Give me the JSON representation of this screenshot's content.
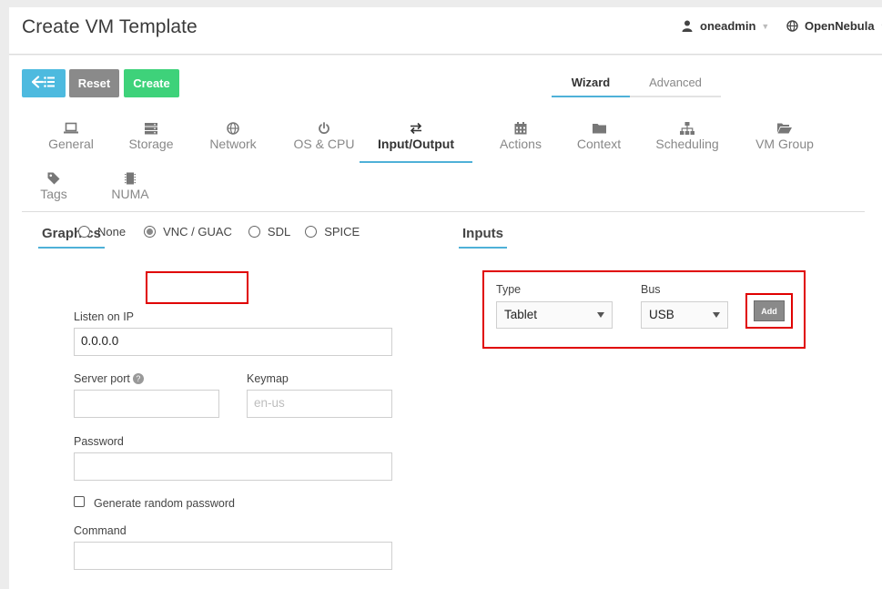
{
  "header": {
    "title": "Create VM Template",
    "user": "oneadmin",
    "zone": "OpenNebula"
  },
  "toolbar": {
    "back_icon": "back-list-icon",
    "reset_label": "Reset",
    "create_label": "Create",
    "colors": {
      "back": "#4dbadf",
      "reset": "#8a8a8a",
      "create": "#3ed27a"
    }
  },
  "mode_tabs": [
    {
      "label": "Wizard",
      "active": true
    },
    {
      "label": "Advanced",
      "active": false
    }
  ],
  "section_tabs": [
    {
      "label": "General",
      "icon": "laptop-icon"
    },
    {
      "label": "Storage",
      "icon": "database-icon"
    },
    {
      "label": "Network",
      "icon": "globe-icon"
    },
    {
      "label": "OS & CPU",
      "icon": "power-icon"
    },
    {
      "label": "Input/Output",
      "icon": "exchange-icon",
      "active": true
    },
    {
      "label": "Actions",
      "icon": "calendar-icon"
    },
    {
      "label": "Context",
      "icon": "folder-icon"
    },
    {
      "label": "Scheduling",
      "icon": "sitemap-icon"
    },
    {
      "label": "VM Group",
      "icon": "folder-open-icon"
    },
    {
      "label": "Tags",
      "icon": "tag-icon"
    },
    {
      "label": "NUMA",
      "icon": "microchip-icon"
    }
  ],
  "graphics": {
    "title": "Graphics",
    "types": [
      {
        "label": "None",
        "checked": false
      },
      {
        "label": "VNC / GUAC",
        "checked": true
      },
      {
        "label": "SDL",
        "checked": false
      },
      {
        "label": "SPICE",
        "checked": false
      }
    ],
    "listen_label": "Listen on IP",
    "listen_value": "0.0.0.0",
    "port_label": "Server port",
    "port_value": "",
    "keymap_label": "Keymap",
    "keymap_placeholder": "en-us",
    "password_label": "Password",
    "password_value": "",
    "random_password_label": "Generate random password",
    "random_password_checked": false,
    "command_label": "Command",
    "command_value": ""
  },
  "inputs": {
    "title": "Inputs",
    "type_label": "Type",
    "type_value": "Tablet",
    "bus_label": "Bus",
    "bus_value": "USB",
    "add_label": "Add"
  },
  "accent_color": "#4fb1d8",
  "highlight_color": "#e00000"
}
